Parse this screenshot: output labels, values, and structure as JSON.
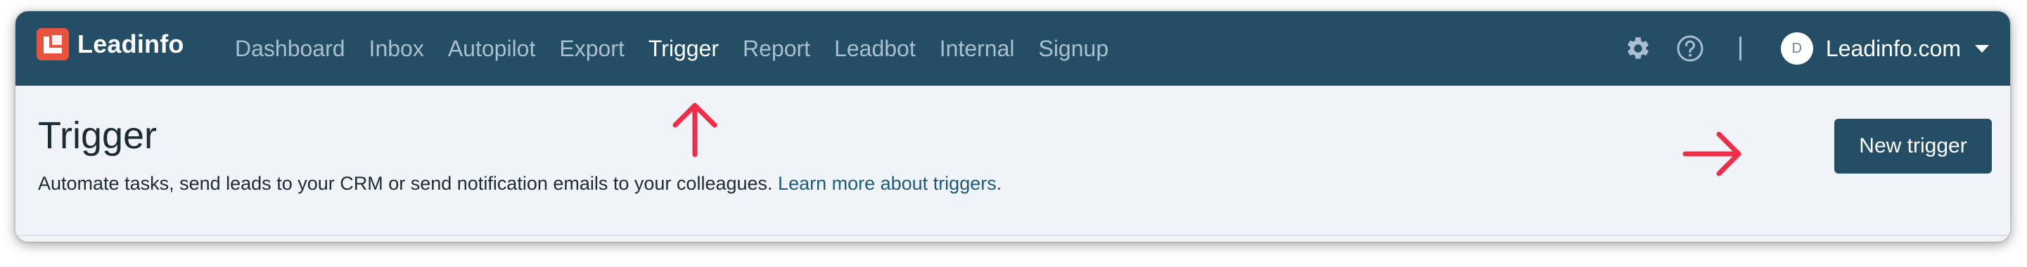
{
  "app": {
    "logo_text": "Leadinfo"
  },
  "nav": {
    "items": [
      {
        "label": "Dashboard",
        "active": false
      },
      {
        "label": "Inbox",
        "active": false
      },
      {
        "label": "Autopilot",
        "active": false
      },
      {
        "label": "Export",
        "active": false
      },
      {
        "label": "Trigger",
        "active": true
      },
      {
        "label": "Report",
        "active": false
      },
      {
        "label": "Leadbot",
        "active": false
      },
      {
        "label": "Internal",
        "active": false
      },
      {
        "label": "Signup",
        "active": false
      }
    ]
  },
  "account": {
    "avatar_initial": "D",
    "name": "Leadinfo.com"
  },
  "page": {
    "title": "Trigger",
    "subtitle": "Automate tasks, send leads to your CRM or send notification emails to your colleagues.",
    "learn_more_link": "Learn more about triggers.",
    "new_button": "New trigger"
  },
  "icons": {
    "settings": "gear-icon",
    "help": "question-circle-icon",
    "account_menu": "caret-down-icon",
    "annotation_up": "arrow-up-icon",
    "annotation_right": "arrow-right-icon"
  },
  "colors": {
    "navbar_bg": "#234e66",
    "nav_text": "#a9bfcd",
    "nav_active": "#ffffff",
    "page_bg": "#f0f3f8",
    "button_bg": "#234e66",
    "link": "#1f5a7a",
    "logo_red": "#e8533f",
    "annotation_arrow": "#ee2d47"
  }
}
